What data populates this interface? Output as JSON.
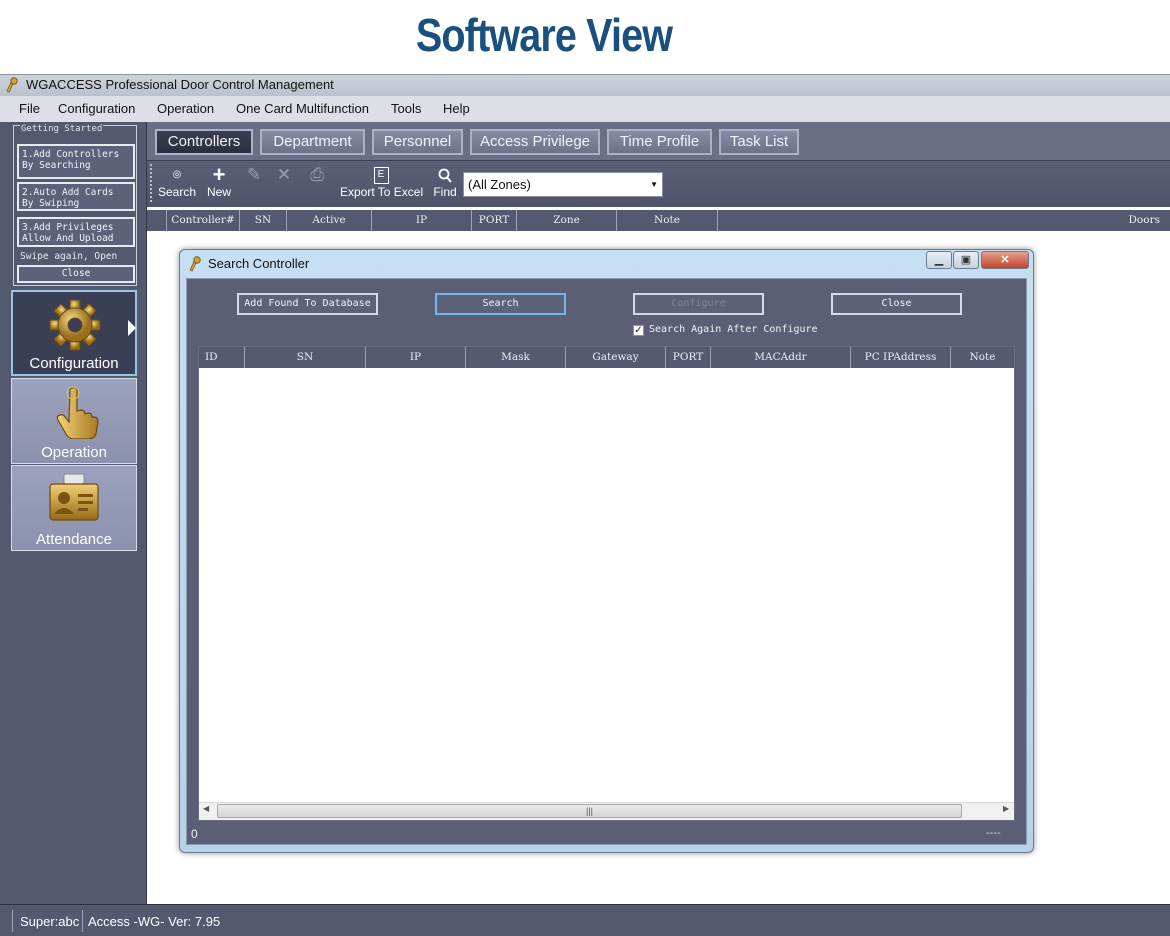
{
  "banner": {
    "title": "Software View"
  },
  "window": {
    "title": "WGACCESS Professional Door Control Management"
  },
  "menu": [
    "File",
    "Configuration",
    "Operation",
    "One Card Multifunction",
    "Tools",
    "Help"
  ],
  "getting_started": {
    "caption": "Getting Started",
    "steps": [
      {
        "line1": "1.Add Controllers",
        "line2": "By Searching"
      },
      {
        "line1": "2.Auto Add Cards",
        "line2": "By Swiping"
      },
      {
        "line1": "3.Add Privileges",
        "line2": "Allow And Upload"
      }
    ],
    "swipe_text": "Swipe again, Open",
    "close_label": "Close"
  },
  "nav": [
    {
      "label": "Configuration",
      "icon": "gear-icon",
      "active": true
    },
    {
      "label": "Operation",
      "icon": "hand-pointer-icon",
      "active": false
    },
    {
      "label": "Attendance",
      "icon": "id-badge-icon",
      "active": false
    }
  ],
  "tabs": [
    "Controllers",
    "Department",
    "Personnel",
    "Access Privilege",
    "Time Profile",
    "Task List"
  ],
  "toolbar": {
    "search_label": "Search",
    "new_label": "New",
    "export_label": "Export To Excel",
    "find_label": "Find",
    "zone_value": "(All Zones)"
  },
  "grid_columns": [
    "Controller#",
    "SN",
    "Active",
    "IP",
    "PORT",
    "Zone",
    "Note",
    "Doors"
  ],
  "dialog": {
    "title": "Search Controller",
    "buttons": {
      "add_found": "Add Found To Database",
      "search": "Search",
      "configure": "Configure",
      "close": "Close"
    },
    "checkbox_label": "Search Again After Configure",
    "checkbox_checked": true,
    "columns": [
      "ID",
      "SN",
      "IP",
      "Mask",
      "Gateway",
      "PORT",
      "MACAddr",
      "PC IPAddress",
      "Note"
    ],
    "status_count": "0",
    "status_right": "----"
  },
  "status": {
    "user": "Super:abc",
    "version": "Access -WG- Ver: 7.95"
  },
  "colors": {
    "brand_title": "#1b4f7e",
    "panel": "#55596f",
    "focus": "#74b6ea"
  }
}
